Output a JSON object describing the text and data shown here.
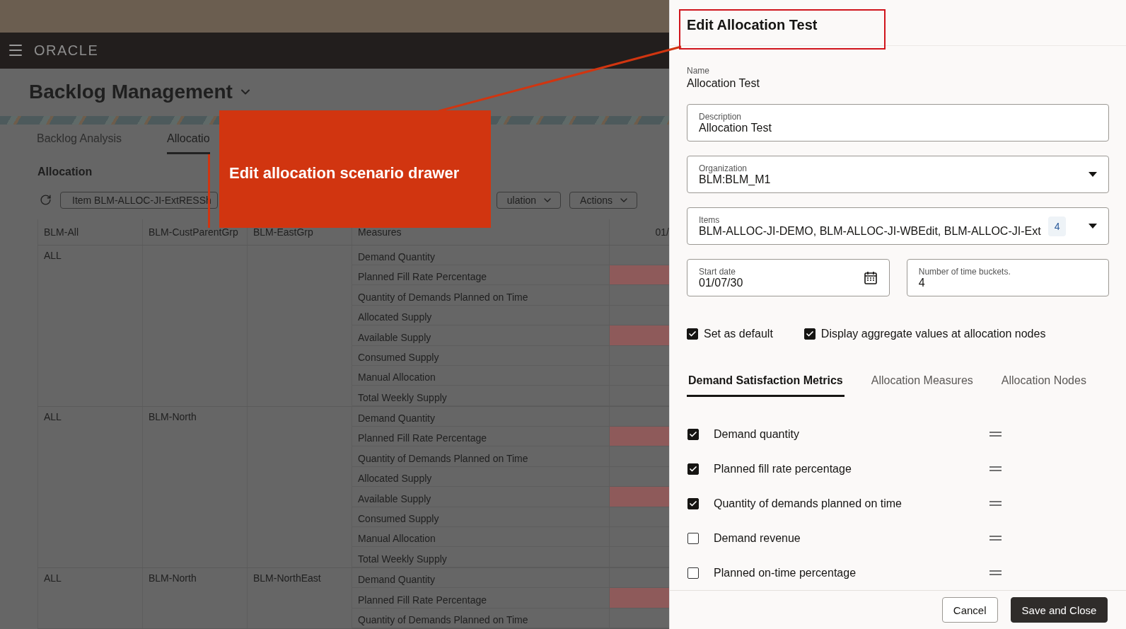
{
  "nav": {
    "logo": "ORACLE"
  },
  "page": {
    "title": "Backlog Management",
    "tabs": [
      {
        "label": "Backlog Analysis",
        "selected": false
      },
      {
        "label": "Allocatio",
        "selected": true
      }
    ],
    "section": "Allocation",
    "toolbar": {
      "filter_chip": "Item BLM-ALLOC-JI-ExtRESSh",
      "dropdowns": [
        "ulation",
        "Actions"
      ]
    },
    "table": {
      "columns": [
        "BLM-All",
        "BLM-CustParentGrp",
        "BLM-EastGrp",
        "Measures",
        "01/"
      ],
      "groups": [
        {
          "col_1": "ALL",
          "rows": [
            {
              "measure": "Demand Quantity",
              "flagged": false
            },
            {
              "measure": "Planned Fill Rate Percentage",
              "flagged": true
            },
            {
              "measure": "Quantity of Demands Planned on Time",
              "flagged": false
            },
            {
              "measure": "Allocated Supply",
              "flagged": false
            },
            {
              "measure": "Available Supply",
              "flagged": true
            },
            {
              "measure": "Consumed Supply",
              "flagged": false
            },
            {
              "measure": "Manual Allocation",
              "flagged": false
            },
            {
              "measure": "Total Weekly Supply",
              "flagged": false
            }
          ]
        },
        {
          "col_1": "ALL",
          "col_2": "BLM-North",
          "rows": [
            {
              "measure": "Demand Quantity",
              "flagged": false
            },
            {
              "measure": "Planned Fill Rate Percentage",
              "flagged": true
            },
            {
              "measure": "Quantity of Demands Planned on Time",
              "flagged": false
            },
            {
              "measure": "Allocated Supply",
              "flagged": false
            },
            {
              "measure": "Available Supply",
              "flagged": true
            },
            {
              "measure": "Consumed Supply",
              "flagged": false
            },
            {
              "measure": "Manual Allocation",
              "flagged": false
            },
            {
              "measure": "Total Weekly Supply",
              "flagged": false
            }
          ]
        },
        {
          "col_1": "ALL",
          "col_2": "BLM-North",
          "col_3": "BLM-NorthEast",
          "rows": [
            {
              "measure": "Demand Quantity",
              "flagged": false
            },
            {
              "measure": "Planned Fill Rate Percentage",
              "flagged": true
            },
            {
              "measure": "Quantity of Demands Planned on Time",
              "flagged": false
            }
          ]
        }
      ]
    }
  },
  "callout": {
    "text": "Edit allocation scenario drawer"
  },
  "drawer": {
    "title": "Edit Allocation Test",
    "name": {
      "label": "Name",
      "value": "Allocation Test"
    },
    "fields": [
      {
        "kind": "text",
        "label": "Description",
        "value": "Allocation Test"
      },
      {
        "kind": "select",
        "label": "Organization",
        "value": "BLM:BLM_M1"
      },
      {
        "kind": "multiselect",
        "label": "Items",
        "value": "BLM-ALLOC-JI-DEMO, BLM-ALLOC-JI-WBEdit, BLM-ALLOC-JI-Ext",
        "count": "4"
      }
    ],
    "date_row": [
      {
        "kind": "date",
        "label": "Start date",
        "value": "01/07/30"
      },
      {
        "kind": "text",
        "label": "Number of time buckets.",
        "value": "4"
      }
    ],
    "options": [
      {
        "label": "Set as default",
        "checked": true
      },
      {
        "label": "Display aggregate values at allocation nodes",
        "checked": true
      }
    ],
    "tabs": [
      {
        "label": "Demand Satisfaction Metrics",
        "selected": true
      },
      {
        "label": "Allocation Measures",
        "selected": false
      },
      {
        "label": "Allocation Nodes",
        "selected": false
      }
    ],
    "metrics": [
      {
        "label": "Demand quantity",
        "checked": true
      },
      {
        "label": "Planned fill rate percentage",
        "checked": true
      },
      {
        "label": "Quantity of demands planned on time",
        "checked": true
      },
      {
        "label": "Demand revenue",
        "checked": false
      },
      {
        "label": "Planned on-time percentage",
        "checked": false
      }
    ],
    "buttons": [
      {
        "label": "Cancel",
        "kind": "secondary"
      },
      {
        "label": "Save and Close",
        "kind": "primary"
      }
    ]
  }
}
